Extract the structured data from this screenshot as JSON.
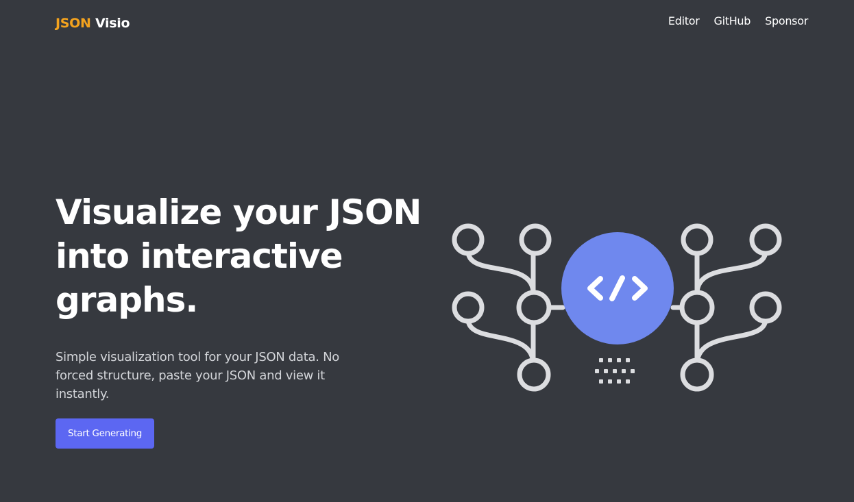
{
  "header": {
    "brand_accent": "JSON",
    "brand_rest": "Visio",
    "nav": [
      {
        "label": "Editor"
      },
      {
        "label": "GitHub"
      },
      {
        "label": "Sponsor"
      }
    ]
  },
  "hero": {
    "title_lines": [
      "Visualize your JSON",
      "into interactive",
      "graphs."
    ],
    "subtitle_lines": [
      "Simple visualization tool for your JSON data. No",
      "forced structure, paste your JSON and view it",
      "instantly."
    ],
    "cta_label": "Start Generating",
    "illustration_glyph": "</>",
    "illustration_icon": "code-tree-graph-icon"
  },
  "colors": {
    "background": "#36393f",
    "brand_accent": "#f4a31e",
    "primary_button": "#5c67f2",
    "illustration_center": "#6f88ee",
    "illustration_lines": "#dcdde0",
    "subtitle_text": "#d3d5d9"
  }
}
